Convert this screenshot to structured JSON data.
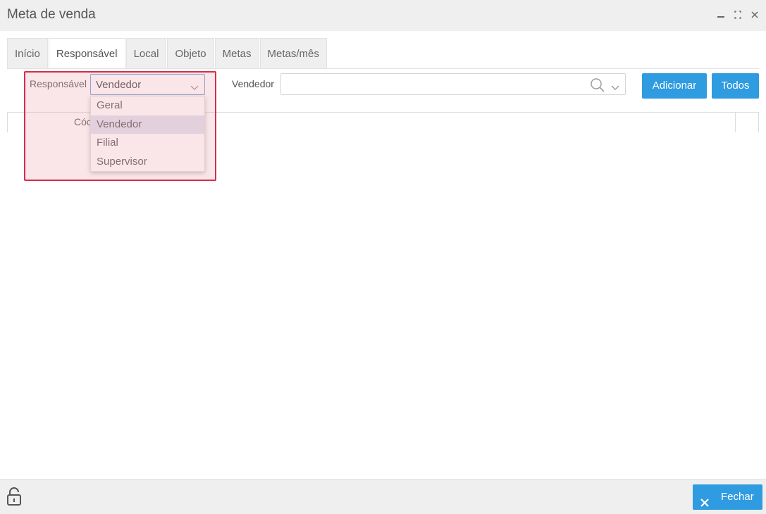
{
  "window": {
    "title": "Meta de venda",
    "controls": [
      "minimize-icon",
      "maximize-icon",
      "close-icon"
    ]
  },
  "tabs": [
    {
      "label": "Início",
      "active": false
    },
    {
      "label": "Responsável",
      "active": true
    },
    {
      "label": "Local",
      "active": false
    },
    {
      "label": "Objeto",
      "active": false
    },
    {
      "label": "Metas",
      "active": false
    },
    {
      "label": "Metas/mês",
      "active": false
    }
  ],
  "form": {
    "responsavel_label": "Responsável",
    "responsavel_value": "Vendedor",
    "responsavel_options": [
      "Geral",
      "Vendedor",
      "Filial",
      "Supervisor"
    ],
    "vendedor_label": "Vendedor",
    "vendedor_value": ""
  },
  "buttons": {
    "adicionar": "Adicionar",
    "todos": "Todos",
    "fechar": "Fechar"
  },
  "grid": {
    "column_partial": "Cóc"
  },
  "colors": {
    "accent": "#2f9be0",
    "highlight_border": "#d0304a",
    "selected_option": "#dde2ef"
  }
}
